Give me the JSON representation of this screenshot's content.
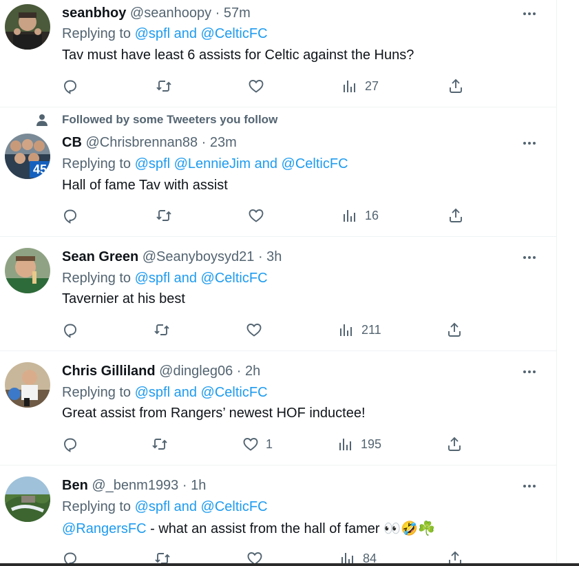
{
  "social_context": "Followed by some Tweeters you follow",
  "reply_prefix": "Replying to",
  "separator": "·",
  "colors": {
    "link": "#1d9bf0",
    "muted": "#536471",
    "text": "#0f1419"
  },
  "tweets": [
    {
      "name": "seanbhoy",
      "handle": "@seanhoopy",
      "time": "57m",
      "replying_to": "@spfl and @CelticFC",
      "text": "Tav must have least 6 assists for Celtic against the Huns?",
      "likes": "",
      "views": "27"
    },
    {
      "name": "CB",
      "handle": "@Chrisbrennan88",
      "time": "23m",
      "replying_to": "@spfl @LennieJim and @CelticFC",
      "text": "Hall of fame Tav with assist",
      "likes": "",
      "views": "16",
      "avatar_badge": "45"
    },
    {
      "name": "Sean Green",
      "handle": "@Seanyboysyd21",
      "time": "3h",
      "replying_to": "@spfl and @CelticFC",
      "text": "Tavernier at his best",
      "likes": "",
      "views": "211"
    },
    {
      "name": "Chris Gilliland",
      "handle": "@dingleg06",
      "time": "2h",
      "replying_to": "@spfl and @CelticFC",
      "text": "Great assist from Rangers’ newest HOF inductee!",
      "likes": "1",
      "views": "195"
    },
    {
      "name": "Ben",
      "handle": "@_benm1993",
      "time": "1h",
      "replying_to": "@spfl and @CelticFC",
      "text_mention": "@RangersFC",
      "text": " - what an assist from the hall of famer 👀🤣☘️",
      "likes": "",
      "views": "84"
    }
  ]
}
